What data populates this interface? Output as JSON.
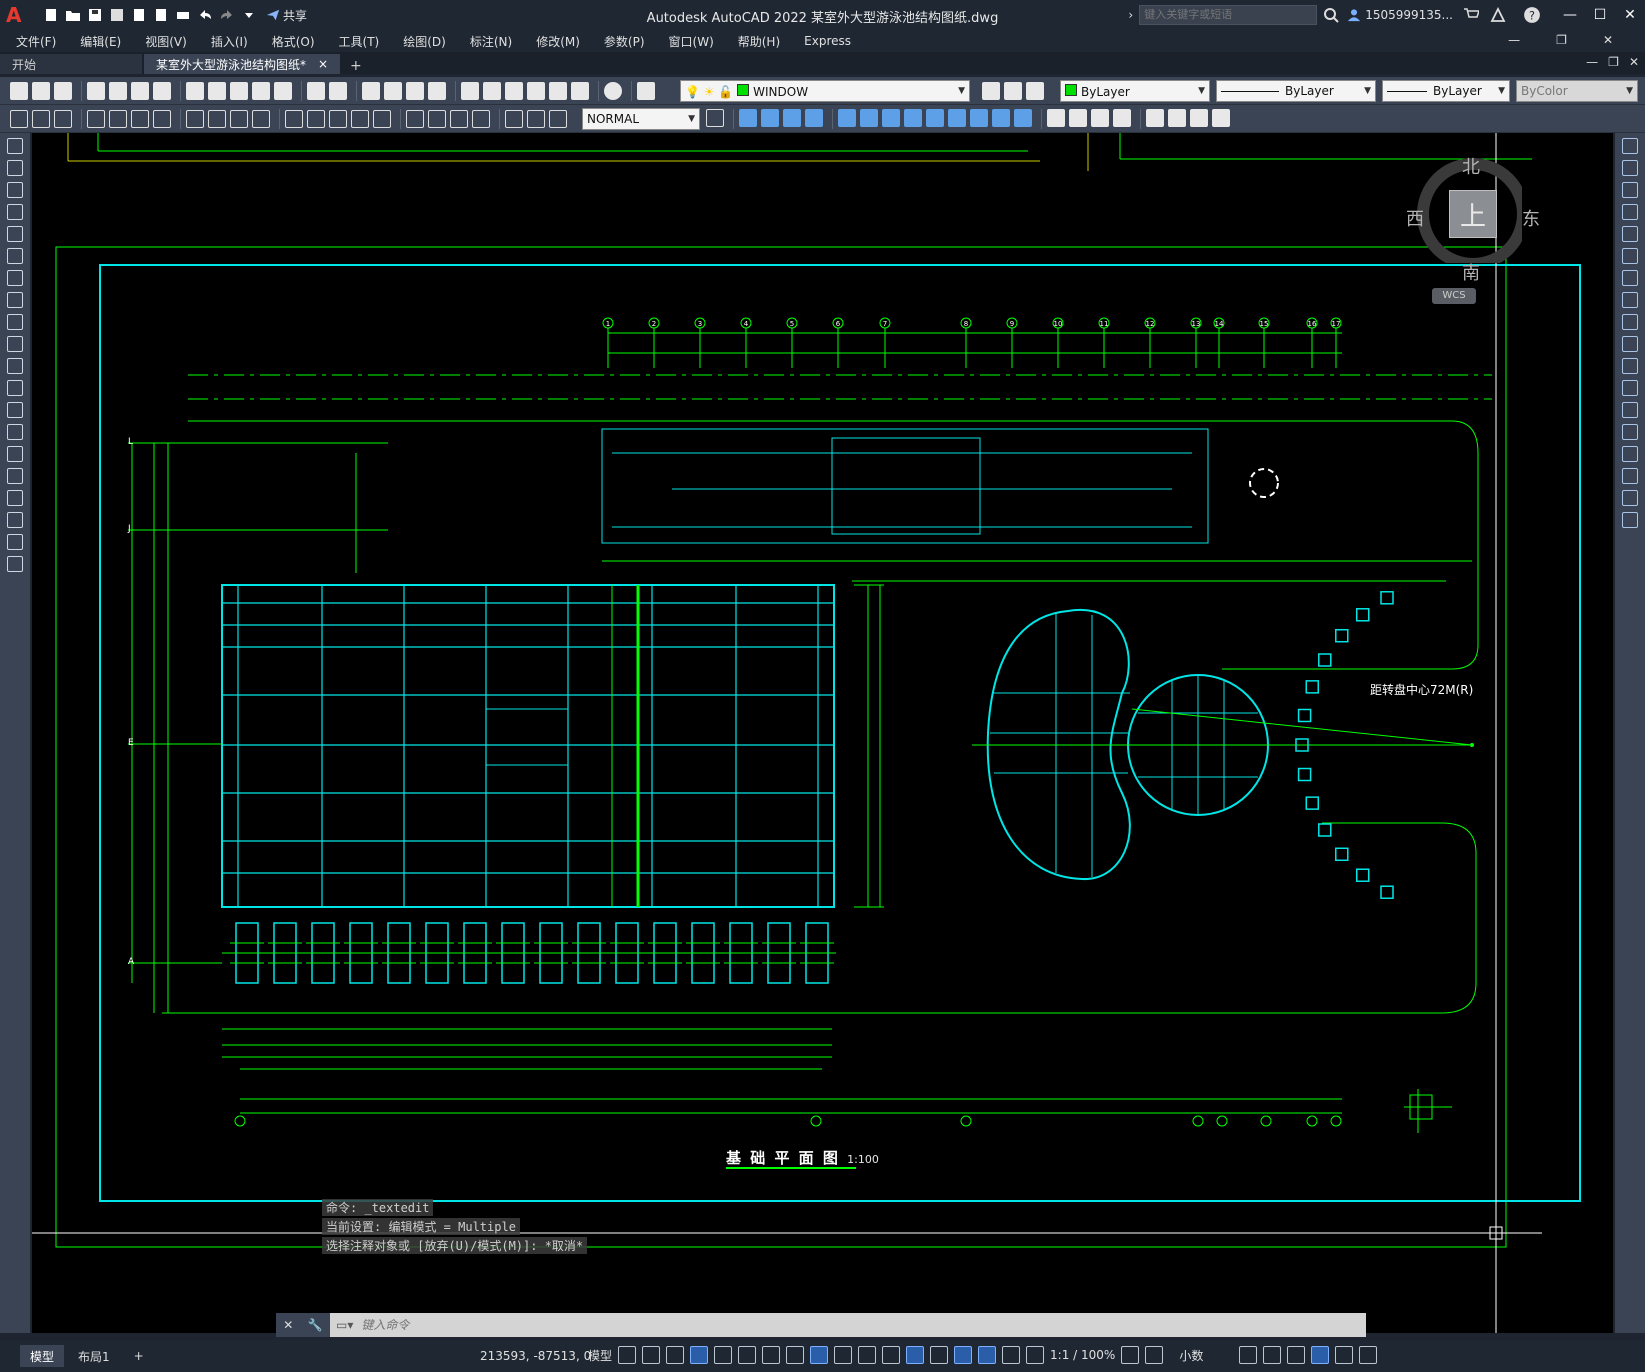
{
  "app": {
    "logo": "A",
    "title": "Autodesk AutoCAD 2022    某室外大型游泳池结构图纸.dwg",
    "share_label": "共享",
    "search_placeholder": "键入关键字或短语",
    "user": "1505999135...",
    "window_controls": [
      "minimize",
      "maximize",
      "close"
    ]
  },
  "menu": [
    "文件(F)",
    "编辑(E)",
    "视图(V)",
    "插入(I)",
    "格式(O)",
    "工具(T)",
    "绘图(D)",
    "标注(N)",
    "修改(M)",
    "参数(P)",
    "窗口(W)",
    "帮助(H)",
    "Express"
  ],
  "tabs": {
    "start": "开始",
    "drawing": "某室外大型游泳池结构图纸*",
    "close": "×",
    "add": "+"
  },
  "toolbar": {
    "layer": "WINDOW",
    "color": "ByLayer",
    "linetype": "ByLayer",
    "lineweight": "ByLayer",
    "plotstyle": "ByColor",
    "dimstyle": "NORMAL"
  },
  "viewcube": {
    "north": "北",
    "south": "南",
    "east": "东",
    "west": "西",
    "top": "上",
    "ucs": "WCS"
  },
  "drawing": {
    "title": "基 础 平 面 图",
    "scale": "1:100",
    "grid_top": [
      "1",
      "2",
      "3",
      "4",
      "5",
      "6",
      "7",
      "8",
      "9",
      "10",
      "11",
      "12",
      "13",
      "14",
      "15",
      "16",
      "17"
    ],
    "grid_left": [
      "L",
      "J",
      "E",
      "A"
    ],
    "radius_note": "距转盘中心72M(R)",
    "colors": {
      "cyan": "#00e5e5",
      "green": "#00ff00",
      "yellow": "#e6e600",
      "white": "#ffffff"
    }
  },
  "command": {
    "history": [
      "命令: _textedit",
      "当前设置: 编辑模式 = Multiple",
      "选择注释对象或 [放弃(U)/模式(M)]: *取消*"
    ],
    "placeholder": "键入命令"
  },
  "status": {
    "model_tab": "模型",
    "layout_tab": "布局1",
    "add_tab": "+",
    "coordinates": "213593, -87513, 0",
    "space": "模型",
    "annotation_scale": "1:1 / 100%",
    "units": "小数"
  }
}
